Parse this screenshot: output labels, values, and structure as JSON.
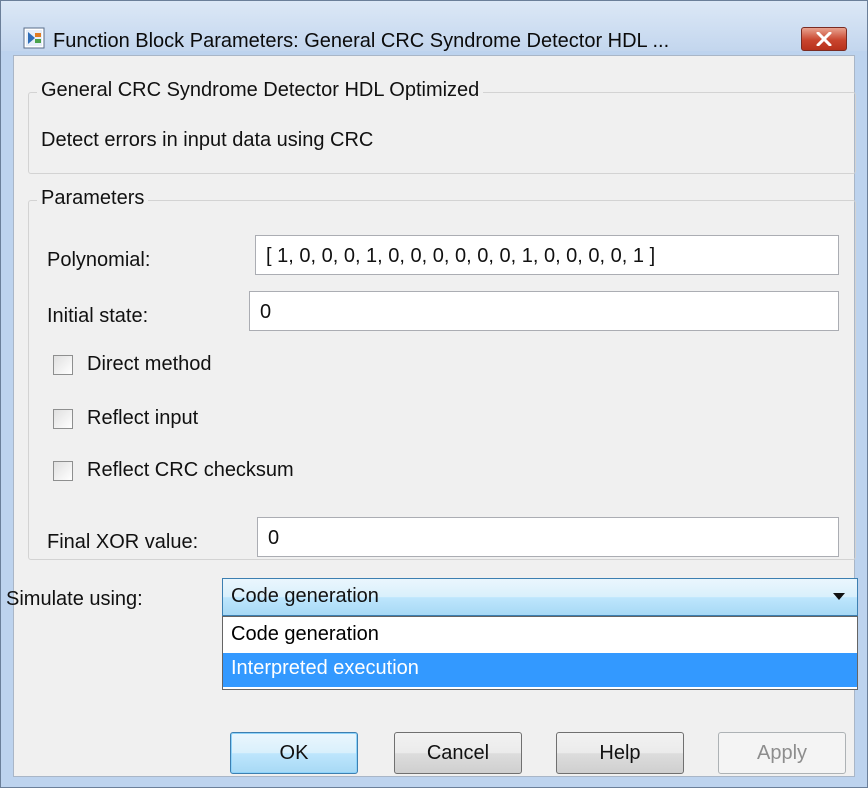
{
  "window": {
    "title": "Function Block Parameters: General CRC Syndrome Detector HDL ...",
    "app_icon": "simulink-block-icon",
    "close_icon": "close-icon"
  },
  "description_group": {
    "legend": "General CRC Syndrome Detector HDL Optimized",
    "text": "Detect errors in input data using CRC"
  },
  "parameters_group": {
    "legend": "Parameters",
    "polynomial_label": "Polynomial:",
    "polynomial_value": "[ 1, 0, 0, 0, 1, 0, 0, 0, 0, 0, 0, 1, 0, 0, 0, 0, 1 ]",
    "initial_state_label": "Initial state:",
    "initial_state_value": "0",
    "checkboxes": [
      {
        "label": "Direct method",
        "checked": false
      },
      {
        "label": "Reflect input",
        "checked": false
      },
      {
        "label": "Reflect CRC checksum",
        "checked": false
      }
    ],
    "final_xor_label": "Final XOR value:",
    "final_xor_value": "0"
  },
  "simulate": {
    "label": "Simulate using:",
    "selected": "Code generation",
    "options": [
      "Code generation",
      "Interpreted execution"
    ],
    "highlighted_option": "Interpreted execution"
  },
  "buttons": {
    "ok": "OK",
    "cancel": "Cancel",
    "help": "Help",
    "apply": "Apply"
  },
  "colors": {
    "highlight": "#3399ff",
    "close_button": "#c9452e",
    "frame": "#bdd3ee"
  }
}
